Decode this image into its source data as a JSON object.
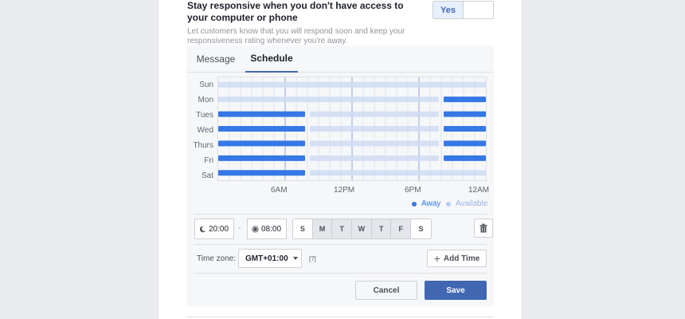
{
  "settings": {
    "heading": "Stay responsive when you don't have access to your computer or phone",
    "description": "Let customers know that you will respond soon and keep your responsiveness rating whenever you're away.",
    "toggle_label": "Yes"
  },
  "tabs": [
    {
      "label": "Message"
    },
    {
      "label": "Schedule"
    }
  ],
  "schedule": {
    "days": [
      "Sun",
      "Mon",
      "Tues",
      "Wed",
      "Thurs",
      "Fri",
      "Sat"
    ],
    "time_labels": [
      "6AM",
      "12PM",
      "6PM",
      "12AM"
    ],
    "hours_range": [
      0,
      24
    ],
    "away_color": "#3578e5",
    "available_color": "#cfdcf5",
    "rows": [
      {
        "day": "Sun",
        "away": []
      },
      {
        "day": "Mon",
        "away": [
          [
            20,
            24
          ]
        ]
      },
      {
        "day": "Tues",
        "away": [
          [
            0,
            8
          ],
          [
            20,
            24
          ]
        ]
      },
      {
        "day": "Wed",
        "away": [
          [
            0,
            8
          ],
          [
            20,
            24
          ]
        ]
      },
      {
        "day": "Thurs",
        "away": [
          [
            0,
            8
          ],
          [
            20,
            24
          ]
        ]
      },
      {
        "day": "Fri",
        "away": [
          [
            0,
            8
          ],
          [
            20,
            24
          ]
        ]
      },
      {
        "day": "Sat",
        "away": [
          [
            0,
            8
          ]
        ]
      }
    ],
    "legend": {
      "away": "Away",
      "available": "Available"
    }
  },
  "controls": {
    "start_time": "20:00",
    "end_time": "08:00",
    "dash": "-",
    "day_buttons": [
      {
        "label": "S",
        "selected": false
      },
      {
        "label": "M",
        "selected": true
      },
      {
        "label": "T",
        "selected": true
      },
      {
        "label": "W",
        "selected": true
      },
      {
        "label": "T",
        "selected": true
      },
      {
        "label": "F",
        "selected": true
      },
      {
        "label": "S",
        "selected": false
      }
    ],
    "timezone_label": "Time zone:",
    "timezone_value": "GMT+01:00",
    "help": "[?]",
    "add_time": "Add Time",
    "cancel": "Cancel",
    "save": "Save"
  }
}
